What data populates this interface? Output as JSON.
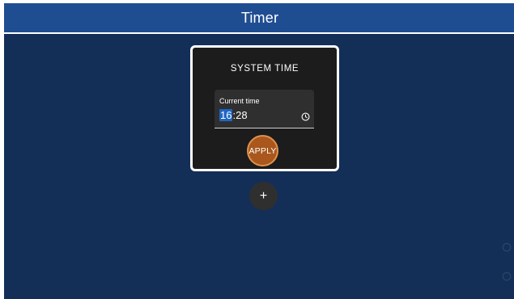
{
  "header": {
    "title": "Timer",
    "accent": "#1f4d92"
  },
  "card": {
    "title": "SYSTEM TIME",
    "field": {
      "label": "Current time",
      "value_hours": "16",
      "value_sep": ":",
      "value_minutes": "28",
      "icon": "clock-icon"
    },
    "apply_label": "APPLY",
    "apply_color": "#a9571c"
  },
  "add_button": {
    "label": "+"
  },
  "colors": {
    "background": "#132f57",
    "card_bg": "#1c1c1c",
    "field_bg": "#2f2f2f",
    "selection": "#1f66c4"
  }
}
